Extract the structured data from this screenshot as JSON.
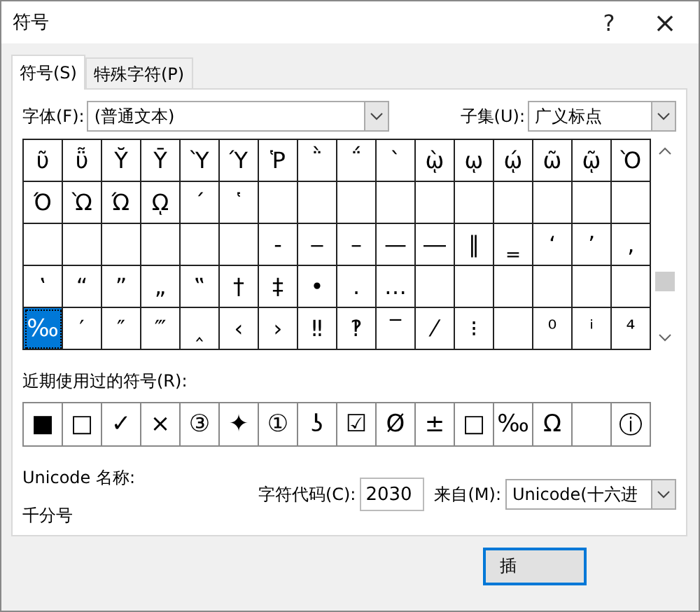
{
  "window": {
    "title": "符号",
    "help": "?",
    "close": "×"
  },
  "tabs": [
    {
      "label": "符号(S)",
      "selected": true
    },
    {
      "label": "特殊字符(P)",
      "selected": false
    }
  ],
  "font": {
    "label": "字体(F):",
    "value": "(普通文本)"
  },
  "subset": {
    "label": "子集(U):",
    "value": "广义标点"
  },
  "grid": [
    [
      {
        "char": "ῦ",
        "selected": false
      },
      {
        "char": "ῧ",
        "selected": false
      },
      {
        "char": "Ῠ",
        "selected": false
      },
      {
        "char": "Ῡ",
        "selected": false
      },
      {
        "char": "Ὺ",
        "selected": false
      },
      {
        "char": "Ύ",
        "selected": false
      },
      {
        "char": "Ῥ",
        "selected": false
      },
      {
        "char": "῭",
        "selected": false
      },
      {
        "char": "΅",
        "selected": false
      },
      {
        "char": "`",
        "selected": false
      },
      {
        "char": "ῲ",
        "selected": false
      },
      {
        "char": "ῳ",
        "selected": false
      },
      {
        "char": "ῴ",
        "selected": false
      },
      {
        "char": "ῶ",
        "selected": false
      },
      {
        "char": "ῷ",
        "selected": false
      },
      {
        "char": "Ὸ",
        "selected": false
      }
    ],
    [
      {
        "char": "Ό",
        "selected": false
      },
      {
        "char": "Ὼ",
        "selected": false
      },
      {
        "char": "Ώ",
        "selected": false
      },
      {
        "char": "ῼ",
        "selected": false
      },
      {
        "char": "´",
        "selected": false
      },
      {
        "char": "῾",
        "selected": false
      },
      {
        "selected": false
      },
      {
        "selected": false
      },
      {
        "selected": false
      },
      {
        "selected": false
      },
      {
        "selected": false
      },
      {
        "selected": false
      },
      {
        "selected": false
      },
      {
        "selected": false
      },
      {
        "selected": false
      },
      {
        "selected": false
      }
    ],
    [
      {
        "selected": false
      },
      {
        "selected": false
      },
      {
        "selected": false
      },
      {
        "selected": false
      },
      {
        "selected": false
      },
      {
        "selected": false
      },
      {
        "char": "‐",
        "selected": false
      },
      {
        "char": "‒",
        "selected": false
      },
      {
        "char": "–",
        "selected": false
      },
      {
        "char": "—",
        "selected": false
      },
      {
        "char": "―",
        "selected": false
      },
      {
        "char": "‖",
        "selected": false
      },
      {
        "char": "‗",
        "selected": false
      },
      {
        "char": "‘",
        "selected": false
      },
      {
        "char": "’",
        "selected": false
      },
      {
        "char": "‚",
        "selected": false
      }
    ],
    [
      {
        "char": "‛",
        "selected": false
      },
      {
        "char": "“",
        "selected": false
      },
      {
        "char": "”",
        "selected": false
      },
      {
        "char": "„",
        "selected": false
      },
      {
        "char": "‟",
        "selected": false
      },
      {
        "char": "†",
        "selected": false
      },
      {
        "char": "‡",
        "selected": false
      },
      {
        "char": "•",
        "selected": false
      },
      {
        "char": ".",
        "selected": false
      },
      {
        "char": "…",
        "selected": false
      },
      {
        "selected": false
      },
      {
        "selected": false
      },
      {
        "selected": false
      },
      {
        "selected": false
      },
      {
        "selected": false
      },
      {
        "selected": false
      }
    ],
    [
      {
        "char": "‰",
        "selected": true
      },
      {
        "char": "′",
        "selected": false
      },
      {
        "char": "″",
        "selected": false
      },
      {
        "char": "‴",
        "selected": false
      },
      {
        "char": "‸",
        "selected": false
      },
      {
        "char": "‹",
        "selected": false
      },
      {
        "char": "›",
        "selected": false
      },
      {
        "char": "‼",
        "selected": false
      },
      {
        "char": "‽",
        "selected": false
      },
      {
        "char": "‾",
        "selected": false
      },
      {
        "char": "⁄",
        "selected": false
      },
      {
        "char": "⁝",
        "selected": false
      },
      {
        "selected": false
      },
      {
        "char": "⁰",
        "selected": false
      },
      {
        "char": "ⁱ",
        "selected": false
      },
      {
        "char": "⁴",
        "selected": false
      }
    ]
  ],
  "recent": {
    "label": "近期使用过的符号(R):",
    "symbols": [
      {
        "kind": "symbol",
        "char": "■"
      },
      {
        "kind": "symbol",
        "char": "□"
      },
      {
        "kind": "symbol",
        "char": "✓"
      },
      {
        "kind": "symbol",
        "char": "×"
      },
      {
        "kind": "symbol",
        "char": "③"
      },
      {
        "kind": "symbol",
        "char": "✦"
      },
      {
        "kind": "symbol",
        "char": "①"
      },
      {
        "kind": "symbol",
        "char": "ʖ"
      },
      {
        "kind": "symbol",
        "char": "☑"
      },
      {
        "kind": "symbol",
        "char": "Ø"
      },
      {
        "kind": "symbol",
        "char": "±"
      },
      {
        "kind": "symbol",
        "char": "□"
      },
      {
        "kind": "symbol",
        "char": "‰"
      },
      {
        "kind": "symbol",
        "char": "Ω"
      },
      {
        "kind": "blank"
      },
      {
        "kind": "symbol",
        "char": "ⓘ"
      }
    ]
  },
  "unicode_name": {
    "label": "Unicode 名称:",
    "value": "千分号"
  },
  "char_code": {
    "label": "字符代码(C):",
    "value": "2030"
  },
  "from": {
    "label": "来自(M):",
    "value": "Unicode(十六进"
  },
  "buttons": [
    {
      "label": "插",
      "default": true
    }
  ]
}
